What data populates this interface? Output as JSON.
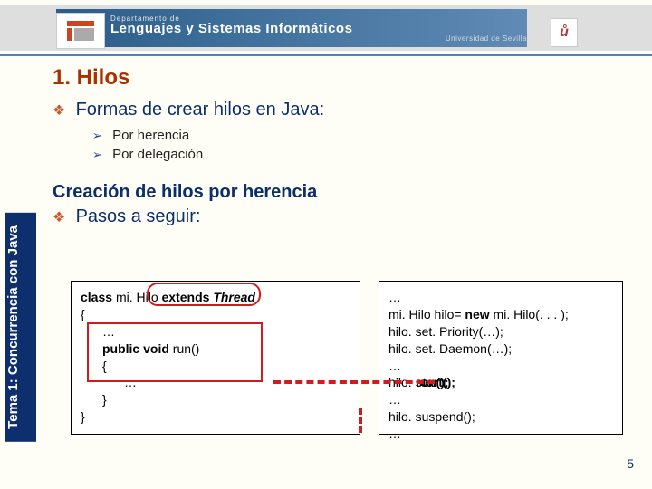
{
  "header": {
    "dept": "Departamento de",
    "title": "Lenguajes y Sistemas Informáticos",
    "uni": "Universidad de Sevilla",
    "logo_right": "ů"
  },
  "sidebar": "Tema 1: Concurrencia con Java",
  "slide_title": "1. Hilos",
  "bullets": {
    "main1": "Formas de crear hilos en Java:",
    "sub1": "Por herencia",
    "sub2": "Por delegación",
    "sub_header": "Creación de hilos por herencia",
    "main2": "Pasos a seguir:"
  },
  "code_left": {
    "l1a": "class ",
    "l1b": "mi. Hilo ",
    "l1c": "extends ",
    "l1d": "Thread",
    "l2": "{",
    "l3": "…",
    "l4a": "public void ",
    "l4b": "run()",
    "l5": "{",
    "l6": "…",
    "l7": "}",
    "l8": "}"
  },
  "code_right": {
    "r1": "…",
    "r2a": "mi. Hilo hilo= ",
    "r2b": "new ",
    "r2c": "mi. Hilo(. . . );",
    "r3": "hilo. set. Priority(…);",
    "r4": "hilo. set. Daemon(…);",
    "r5": "…",
    "r6a": "hilo. ",
    "r6b": "start();",
    "r6c": "run();",
    "r7": "…",
    "r8": "hilo. suspend();",
    "r9": "…"
  },
  "page_number": "5"
}
